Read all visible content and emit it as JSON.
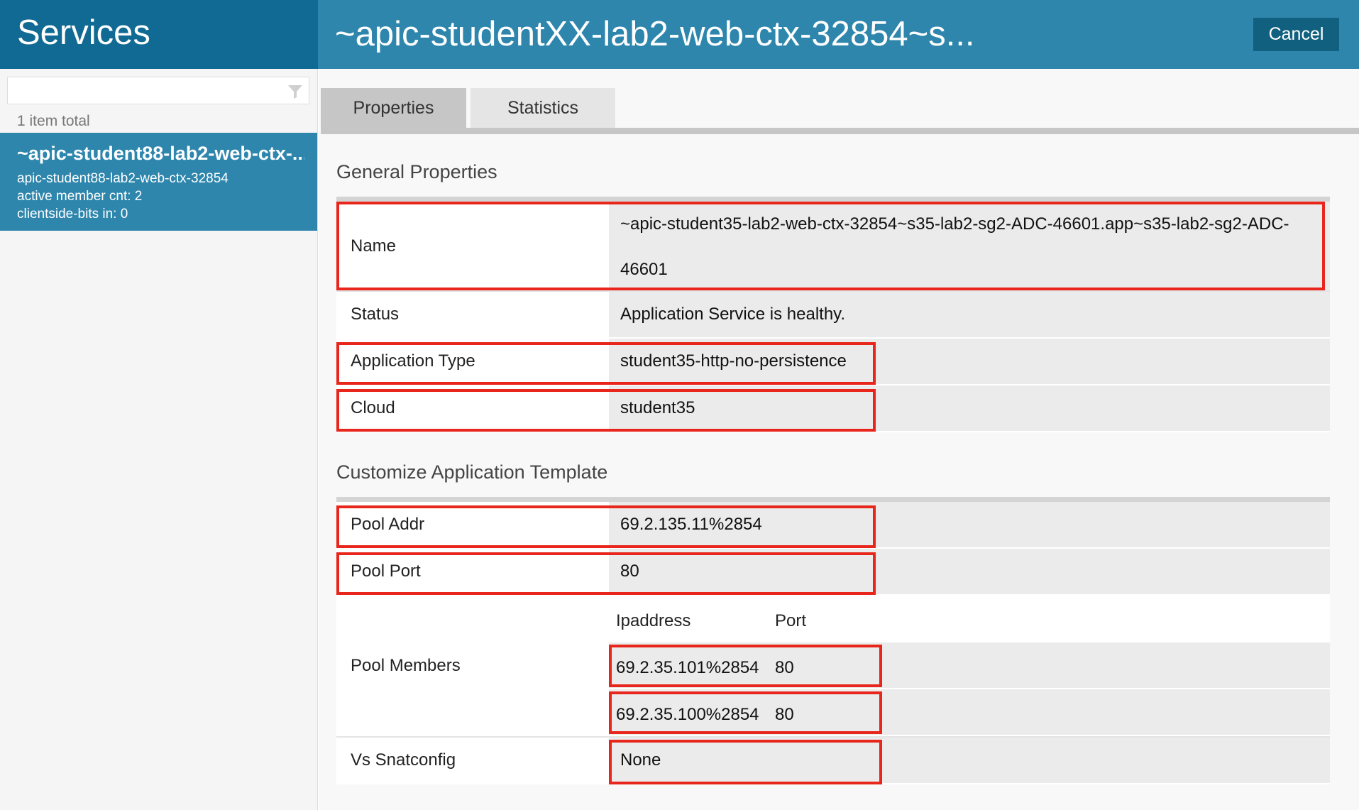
{
  "header": {
    "section_title": "Services",
    "detail_title": "~apic-studentXX-lab2-web-ctx-32854~s...",
    "cancel_label": "Cancel"
  },
  "sidebar": {
    "filter": {
      "value": "",
      "placeholder": ""
    },
    "item_count": "1 item total",
    "items": [
      {
        "name": "~apic-student88-lab2-web-ctx-...",
        "line1": "apic-student88-lab2-web-ctx-32854",
        "line2": "active member cnt: 2",
        "line3": "clientside-bits in: 0"
      }
    ]
  },
  "tabs": [
    {
      "label": "Properties",
      "active": true
    },
    {
      "label": "Statistics",
      "active": false
    }
  ],
  "general": {
    "title": "General Properties",
    "name_label": "Name",
    "name_value": "~apic-student35-lab2-web-ctx-32854~s35-lab2-sg2-ADC-46601.app~s35-lab2-sg2-ADC-46601",
    "status_label": "Status",
    "status_value": "Application Service is healthy.",
    "app_type_label": "Application Type",
    "app_type_value": "student35-http-no-persistence",
    "cloud_label": "Cloud",
    "cloud_value": "student35"
  },
  "template": {
    "title": "Customize Application Template",
    "pool_addr_label": "Pool Addr",
    "pool_addr_value": "69.2.135.11%2854",
    "pool_port_label": "Pool Port",
    "pool_port_value": "80",
    "pool_members_label": "Pool Members",
    "pool_members_columns": [
      "Ipaddress",
      "Port"
    ],
    "pool_members": [
      {
        "ip": "69.2.35.101%2854",
        "port": "80"
      },
      {
        "ip": "69.2.35.100%2854",
        "port": "80"
      }
    ],
    "snat_label": "Vs Snatconfig",
    "snat_value": "None"
  },
  "colors": {
    "header_dark": "#116a93",
    "header_accent": "#2e86ad",
    "highlight": "#e8261c"
  }
}
